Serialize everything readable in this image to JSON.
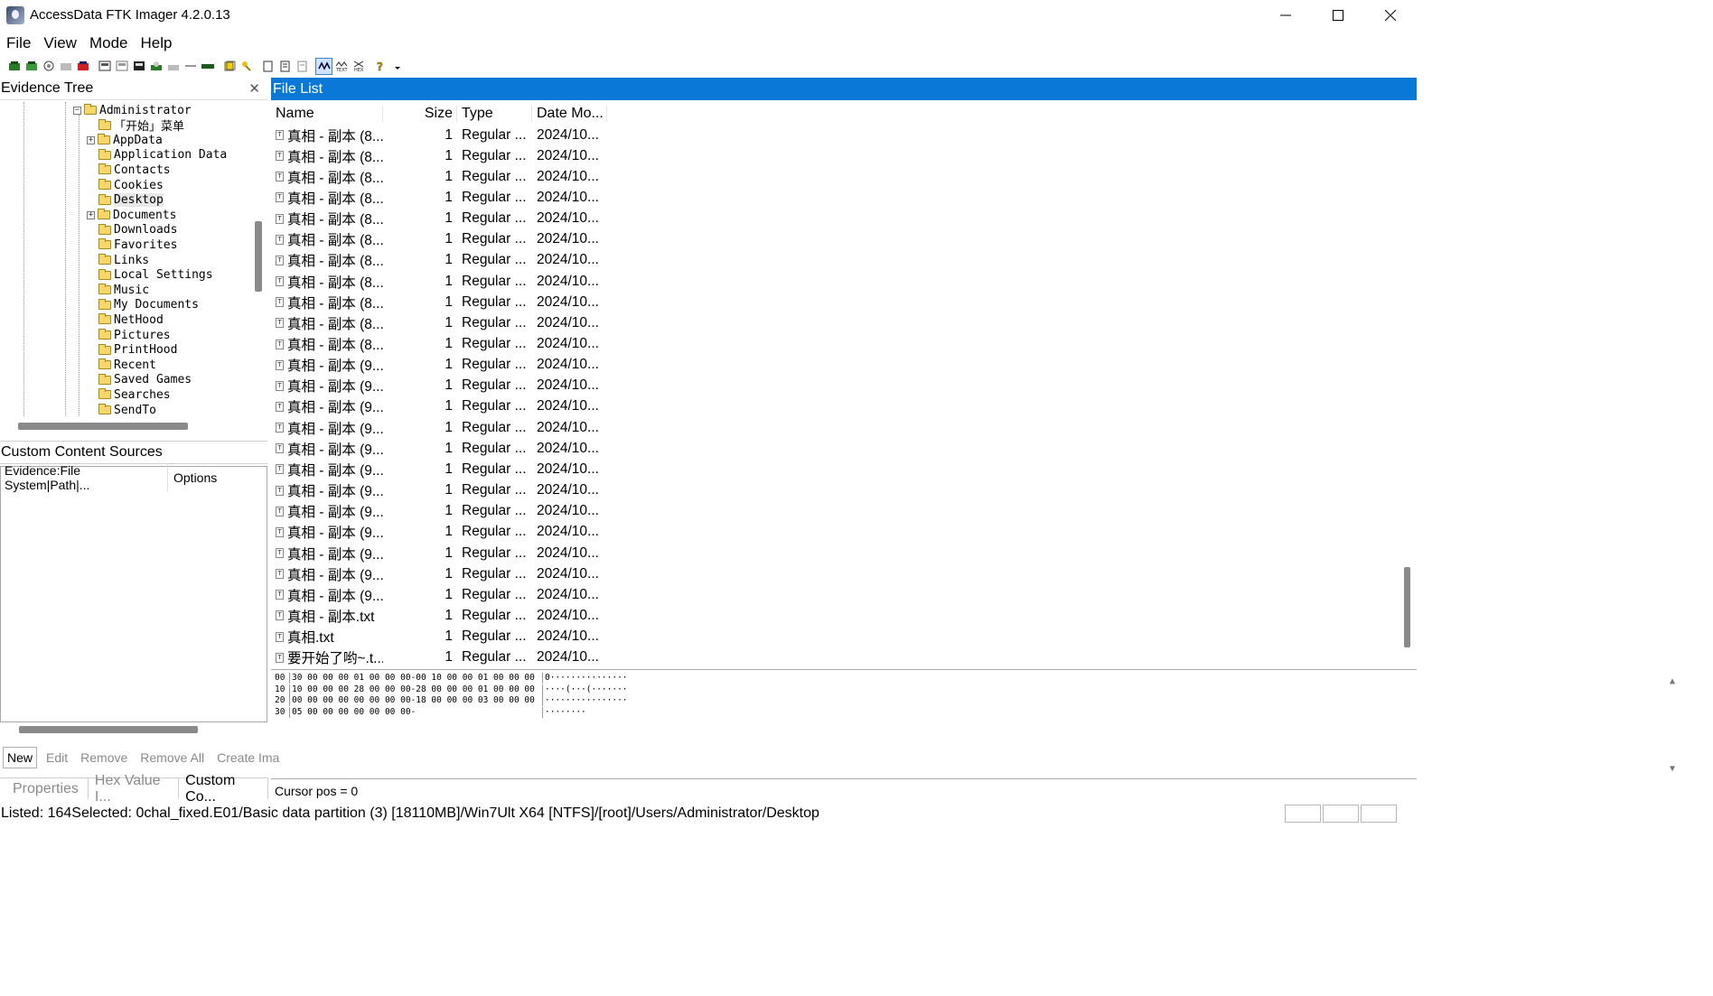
{
  "window": {
    "title": "AccessData FTK Imager 4.2.0.13"
  },
  "menu": [
    "File",
    "View",
    "Mode",
    "Help"
  ],
  "evidence_tree": {
    "title": "Evidence Tree",
    "items": [
      {
        "label": "Administrator",
        "expander": "−"
      },
      {
        "label": "「开始」菜单",
        "expander": ""
      },
      {
        "label": "AppData",
        "expander": "+"
      },
      {
        "label": "Application Data",
        "expander": ""
      },
      {
        "label": "Contacts",
        "expander": ""
      },
      {
        "label": "Cookies",
        "expander": ""
      },
      {
        "label": "Desktop",
        "expander": "",
        "selected": true
      },
      {
        "label": "Documents",
        "expander": "+"
      },
      {
        "label": "Downloads",
        "expander": ""
      },
      {
        "label": "Favorites",
        "expander": ""
      },
      {
        "label": "Links",
        "expander": ""
      },
      {
        "label": "Local Settings",
        "expander": ""
      },
      {
        "label": "Music",
        "expander": ""
      },
      {
        "label": "My Documents",
        "expander": ""
      },
      {
        "label": "NetHood",
        "expander": ""
      },
      {
        "label": "Pictures",
        "expander": ""
      },
      {
        "label": "PrintHood",
        "expander": ""
      },
      {
        "label": "Recent",
        "expander": ""
      },
      {
        "label": "Saved Games",
        "expander": ""
      },
      {
        "label": "Searches",
        "expander": ""
      },
      {
        "label": "SendTo",
        "expander": ""
      }
    ]
  },
  "custom_content": {
    "title": "Custom Content Sources",
    "columns": [
      "Evidence:File System|Path|...",
      "Options"
    ],
    "buttons": [
      "New",
      "Edit",
      "Remove",
      "Remove All",
      "Create Ima"
    ]
  },
  "left_tabs": [
    "Properties",
    "Hex Value I...",
    "Custom Co..."
  ],
  "file_list": {
    "title": "File List",
    "columns": [
      "Name",
      "Size",
      "Type",
      "Date Mo..."
    ],
    "rows": [
      {
        "name": "真相 - 副本 (8...",
        "size": "1",
        "type": "Regular ...",
        "date": "2024/10..."
      },
      {
        "name": "真相 - 副本 (8...",
        "size": "1",
        "type": "Regular ...",
        "date": "2024/10..."
      },
      {
        "name": "真相 - 副本 (8...",
        "size": "1",
        "type": "Regular ...",
        "date": "2024/10..."
      },
      {
        "name": "真相 - 副本 (8...",
        "size": "1",
        "type": "Regular ...",
        "date": "2024/10..."
      },
      {
        "name": "真相 - 副本 (8...",
        "size": "1",
        "type": "Regular ...",
        "date": "2024/10..."
      },
      {
        "name": "真相 - 副本 (8...",
        "size": "1",
        "type": "Regular ...",
        "date": "2024/10..."
      },
      {
        "name": "真相 - 副本 (8...",
        "size": "1",
        "type": "Regular ...",
        "date": "2024/10..."
      },
      {
        "name": "真相 - 副本 (8...",
        "size": "1",
        "type": "Regular ...",
        "date": "2024/10..."
      },
      {
        "name": "真相 - 副本 (8...",
        "size": "1",
        "type": "Regular ...",
        "date": "2024/10..."
      },
      {
        "name": "真相 - 副本 (8...",
        "size": "1",
        "type": "Regular ...",
        "date": "2024/10..."
      },
      {
        "name": "真相 - 副本 (8...",
        "size": "1",
        "type": "Regular ...",
        "date": "2024/10..."
      },
      {
        "name": "真相 - 副本 (9...",
        "size": "1",
        "type": "Regular ...",
        "date": "2024/10..."
      },
      {
        "name": "真相 - 副本 (9...",
        "size": "1",
        "type": "Regular ...",
        "date": "2024/10..."
      },
      {
        "name": "真相 - 副本 (9...",
        "size": "1",
        "type": "Regular ...",
        "date": "2024/10..."
      },
      {
        "name": "真相 - 副本 (9...",
        "size": "1",
        "type": "Regular ...",
        "date": "2024/10..."
      },
      {
        "name": "真相 - 副本 (9...",
        "size": "1",
        "type": "Regular ...",
        "date": "2024/10..."
      },
      {
        "name": "真相 - 副本 (9...",
        "size": "1",
        "type": "Regular ...",
        "date": "2024/10..."
      },
      {
        "name": "真相 - 副本 (9...",
        "size": "1",
        "type": "Regular ...",
        "date": "2024/10..."
      },
      {
        "name": "真相 - 副本 (9...",
        "size": "1",
        "type": "Regular ...",
        "date": "2024/10..."
      },
      {
        "name": "真相 - 副本 (9...",
        "size": "1",
        "type": "Regular ...",
        "date": "2024/10..."
      },
      {
        "name": "真相 - 副本 (9...",
        "size": "1",
        "type": "Regular ...",
        "date": "2024/10..."
      },
      {
        "name": "真相 - 副本 (9...",
        "size": "1",
        "type": "Regular ...",
        "date": "2024/10..."
      },
      {
        "name": "真相 - 副本 (9...",
        "size": "1",
        "type": "Regular ...",
        "date": "2024/10..."
      },
      {
        "name": "真相 - 副本.txt",
        "size": "1",
        "type": "Regular ...",
        "date": "2024/10..."
      },
      {
        "name": "真相.txt",
        "size": "1",
        "type": "Regular ...",
        "date": "2024/10..."
      },
      {
        "name": "要开始了哟~.t...",
        "size": "1",
        "type": "Regular ...",
        "date": "2024/10..."
      }
    ]
  },
  "hex_view": {
    "rows": [
      {
        "offset": "00",
        "bytes": "30 00 00 00 01 00 00 00-00 10 00 00 01 00 00 00",
        "ascii": "0···············"
      },
      {
        "offset": "10",
        "bytes": "10 00 00 00 28 00 00 00-28 00 00 00 01 00 00 00",
        "ascii": "····(···(·······"
      },
      {
        "offset": "20",
        "bytes": "00 00 00 00 00 00 00 00-18 00 00 00 03 00 00 00",
        "ascii": "················"
      },
      {
        "offset": "30",
        "bytes": "05 00 00 00 00 00 00 00-",
        "ascii": "········"
      }
    ],
    "cursor": "Cursor pos = 0"
  },
  "status": {
    "text": "Listed: 164Selected: 0chal_fixed.E01/Basic data partition (3) [18110MB]/Win7Ult X64 [NTFS]/[root]/Users/Administrator/Desktop"
  },
  "colors": {
    "accent": "#0a78d7",
    "folder": "#f7d66a",
    "scrollbar": "#8a8a8a"
  }
}
